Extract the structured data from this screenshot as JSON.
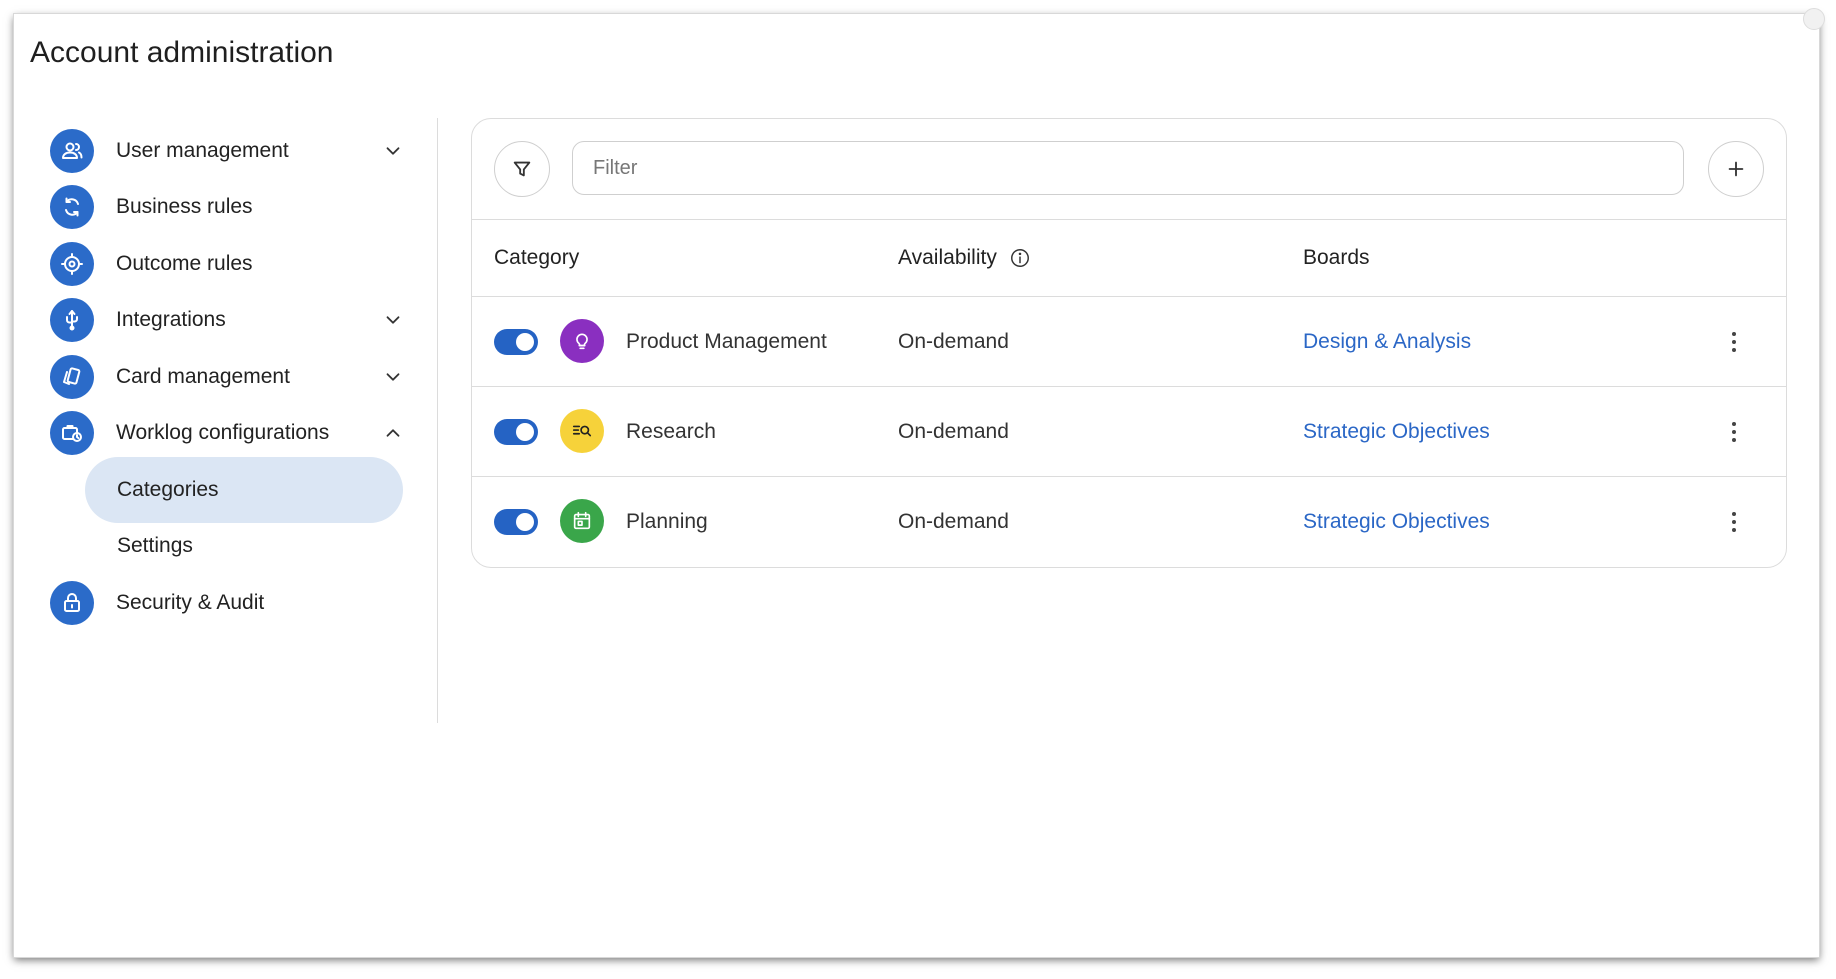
{
  "app": {
    "title": "Account administration"
  },
  "sidebar": {
    "items": [
      {
        "label": "User management",
        "icon": "users-icon"
      },
      {
        "label": "Business rules",
        "icon": "refresh-icon"
      },
      {
        "label": "Outcome rules",
        "icon": "target-icon"
      },
      {
        "label": "Integrations",
        "icon": "usb-icon"
      },
      {
        "label": "Card management",
        "icon": "cards-icon"
      },
      {
        "label": "Worklog configurations",
        "icon": "briefcase-clock-icon"
      },
      {
        "label": "Security & Audit",
        "icon": "lock-icon"
      }
    ],
    "sub_items": [
      {
        "label": "Categories",
        "active": true
      },
      {
        "label": "Settings",
        "active": false
      }
    ]
  },
  "toolbar": {
    "filter_placeholder": "Filter",
    "filter_value": ""
  },
  "table": {
    "headers": {
      "category": "Category",
      "availability": "Availability",
      "boards": "Boards"
    },
    "rows": [
      {
        "enabled": true,
        "icon": "lightbulb-icon",
        "icon_color": "#8a2fc0",
        "category": "Product Management",
        "availability": "On-demand",
        "boards": "Design & Analysis"
      },
      {
        "enabled": true,
        "icon": "list-search-icon",
        "icon_color": "#f6d23a",
        "category": "Research",
        "availability": "On-demand",
        "boards": "Strategic Objectives"
      },
      {
        "enabled": true,
        "icon": "calendar-icon",
        "icon_color": "#3aa64a",
        "category": "Planning",
        "availability": "On-demand",
        "boards": "Strategic Objectives"
      }
    ]
  },
  "colors": {
    "accent": "#2b6bc9",
    "active_bg": "#dbe6f4",
    "link": "#2b67c6"
  }
}
